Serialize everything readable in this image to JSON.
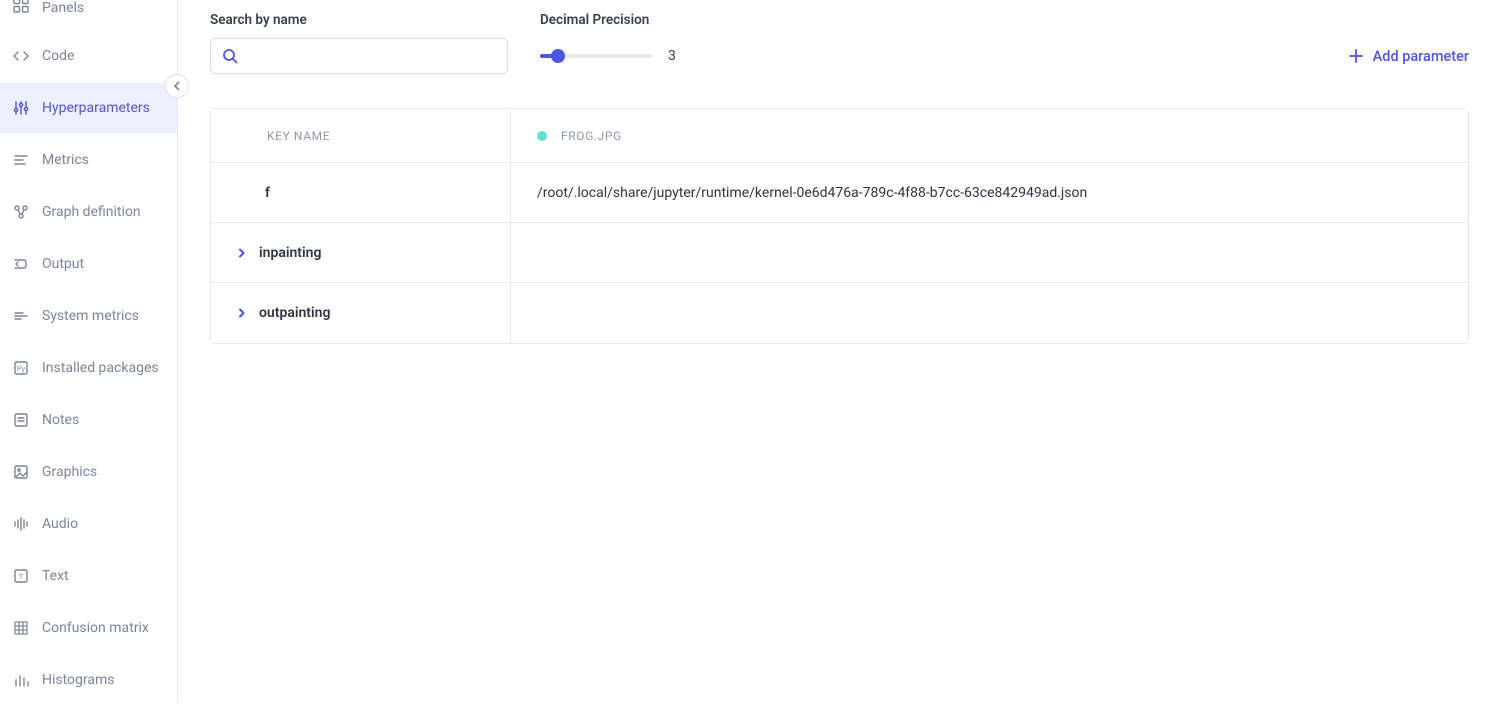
{
  "sidebar": {
    "items": [
      {
        "id": "panels",
        "label": "Panels",
        "icon": "panels-icon",
        "active": false
      },
      {
        "id": "code",
        "label": "Code",
        "icon": "code-icon",
        "active": false
      },
      {
        "id": "hyperparameters",
        "label": "Hyperparameters",
        "icon": "sliders-icon",
        "active": true
      },
      {
        "id": "metrics",
        "label": "Metrics",
        "icon": "metrics-icon",
        "active": false
      },
      {
        "id": "graph-definition",
        "label": "Graph definition",
        "icon": "graph-icon",
        "active": false
      },
      {
        "id": "output",
        "label": "Output",
        "icon": "output-icon",
        "active": false
      },
      {
        "id": "system-metrics",
        "label": "System metrics",
        "icon": "system-metrics-icon",
        "active": false
      },
      {
        "id": "installed-packages",
        "label": "Installed packages",
        "icon": "package-icon",
        "active": false
      },
      {
        "id": "notes",
        "label": "Notes",
        "icon": "notes-icon",
        "active": false
      },
      {
        "id": "graphics",
        "label": "Graphics",
        "icon": "image-icon",
        "active": false
      },
      {
        "id": "audio",
        "label": "Audio",
        "icon": "audio-icon",
        "active": false
      },
      {
        "id": "text",
        "label": "Text",
        "icon": "text-icon",
        "active": false
      },
      {
        "id": "confusion-matrix",
        "label": "Confusion matrix",
        "icon": "matrix-icon",
        "active": false
      },
      {
        "id": "histograms",
        "label": "Histograms",
        "icon": "histogram-icon",
        "active": false
      }
    ]
  },
  "toolbar": {
    "search_label": "Search by name",
    "search_placeholder": "",
    "precision_label": "Decimal Precision",
    "precision_value": "3",
    "add_param_label": "Add parameter"
  },
  "table": {
    "header": {
      "key_label": "KEY NAME",
      "value_label": "FROG.JPG",
      "status_color": "#5fe0d3"
    },
    "rows": [
      {
        "type": "plain",
        "key": "f",
        "value": "/root/.local/share/jupyter/runtime/kernel-0e6d476a-789c-4f88-b7cc-63ce842949ad.json"
      },
      {
        "type": "expandable",
        "key": "inpainting",
        "value": ""
      },
      {
        "type": "expandable",
        "key": "outpainting",
        "value": ""
      }
    ]
  }
}
